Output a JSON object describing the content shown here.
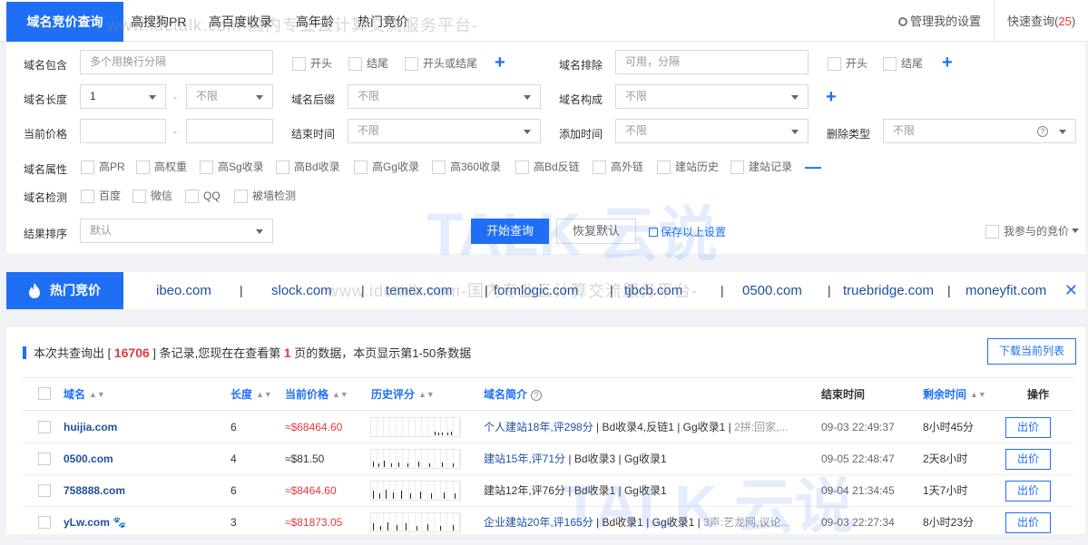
{
  "tabs": [
    {
      "label": "域名竞价查询",
      "active": true
    },
    {
      "label": "高搜狗PR"
    },
    {
      "label": "高百度收录"
    },
    {
      "label": "高年龄"
    },
    {
      "label": "热门竞价"
    }
  ],
  "top_right": {
    "settings_label": "管理我的设置",
    "quick_label": "快速查询(",
    "quick_count": "25",
    "quick_close": ")"
  },
  "filters": {
    "contains_label": "域名包含",
    "contains_placeholder": "多个用换行分隔",
    "contains_opts": [
      "开头",
      "结尾",
      "开头或结尾"
    ],
    "exclude_label": "域名排除",
    "exclude_placeholder": "可用，分隔",
    "exclude_opts": [
      "开头",
      "结尾"
    ],
    "length_label": "域名长度",
    "length_min": "1",
    "length_max": "不限",
    "suffix_label": "域名后缀",
    "suffix_value": "不限",
    "compose_label": "域名构成",
    "compose_value": "不限",
    "price_label": "当前价格",
    "end_label": "结束时间",
    "end_value": "不限",
    "add_label": "添加时间",
    "add_value": "不限",
    "delete_label": "删除类型",
    "delete_value": "不限",
    "attr_label": "域名属性",
    "attrs": [
      "高PR",
      "高权重",
      "高Sg收录",
      "高Bd收录",
      "高Gg收录",
      "高360收录",
      "高Bd反链",
      "高外链",
      "建站历史",
      "建站记录"
    ],
    "check_label": "域名检测",
    "checks": [
      "百度",
      "微信",
      "QQ",
      "被墙检测"
    ],
    "sort_label": "结果排序",
    "sort_value": "默认",
    "search_button": "开始查询",
    "reset_button": "恢复默认",
    "save_link": "保存以上设置",
    "my_bids": "我参与的竞价"
  },
  "hot": {
    "title": "热门竞价",
    "items": [
      "ibeo.com",
      "slock.com",
      "temex.com",
      "formlogic.com",
      "tjbcb.com",
      "0500.com",
      "truebridge.com",
      "moneyfit.com"
    ],
    "sep": "|"
  },
  "results": {
    "summary_pre": "本次共查询出 [ ",
    "total": "16706",
    "summary_mid": " ] 条记录,您现在在查看第 ",
    "page": "1",
    "summary_post": " 页的数据，本页显示第1-50条数据",
    "download_button": "下载当前列表",
    "columns": {
      "domain": "域名",
      "length": "长度",
      "price": "当前价格",
      "history": "历史评分",
      "intro": "域名简介",
      "end": "结束时间",
      "remain": "剩余时间",
      "action": "操作"
    },
    "rows": [
      {
        "domain": "huijia.com",
        "length": "6",
        "price": "≈$68464.60",
        "price_red": true,
        "intro_blue": "个人建站18年,评298分",
        "intro_rest": " | Bd收录4,反链1 | Gg收录1 | ",
        "intro_grey": "2拼:回家,...",
        "end": "09-03 22:49:37",
        "remain": "8小时45分",
        "action": "出价"
      },
      {
        "domain": "0500.com",
        "length": "4",
        "price": "≈$81.50",
        "price_red": false,
        "intro_blue": "建站15年,评71分",
        "intro_rest": " | Bd收录3 | Gg收录1",
        "intro_grey": "",
        "end": "09-05 22:48:47",
        "remain": "2天8小时",
        "action": "出价"
      },
      {
        "domain": "758888.com",
        "length": "6",
        "price": "≈$8464.60",
        "price_red": true,
        "intro_blue": "",
        "intro_rest": "建站12年,评76分 | Bd收录1 | Gg收录1",
        "intro_grey": "",
        "end": "09-04 21:34:45",
        "remain": "1天7小时",
        "action": "出价"
      },
      {
        "domain": "yLw.com",
        "length": "3",
        "price": "≈$81873.05",
        "price_red": true,
        "intro_blue": "企业建站20年,评165分",
        "intro_rest": " | Bd收录1 | Gg收录1 | ",
        "intro_grey": "3声:艺龙网,议论...",
        "end": "09-03 22:27:34",
        "remain": "8小时23分",
        "action": "出价"
      }
    ]
  },
  "watermark": {
    "brand": "TALK 云说",
    "site_text": "www.idctalk.com-国内专业云计算交流服务平台-"
  }
}
